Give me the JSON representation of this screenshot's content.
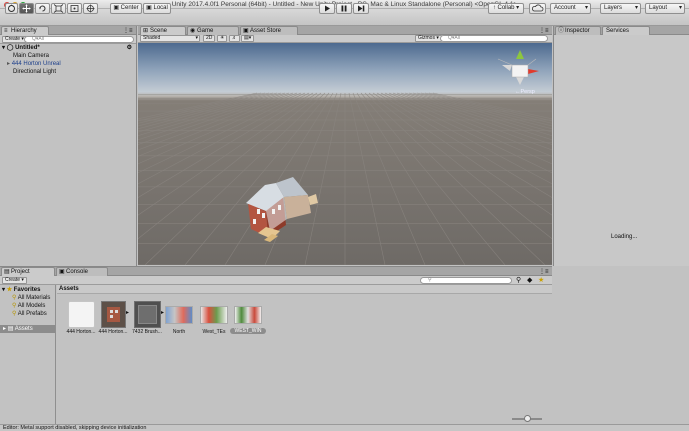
{
  "window": {
    "title": "Unity 2017.4.0f1 Personal (64bit) - Untitled - New Unity Project - PC, Mac & Linux Standalone (Personal) <OpenGL 4.1>"
  },
  "toolbar": {
    "pivot_label": "Center",
    "space_label": "Local",
    "collab_label": "Collab ▾",
    "account_label": "Account",
    "layers_label": "Layers",
    "layout_label": "Layout"
  },
  "hierarchy": {
    "tab_label": "Hierarchy",
    "create_label": "Create ▾",
    "search_placeholder": "Q▾All",
    "scene_name": "Untitled*",
    "items": [
      {
        "label": "Main Camera"
      },
      {
        "label": "444 Horton Unreal"
      },
      {
        "label": "Directional Light"
      }
    ]
  },
  "scene": {
    "tabs": [
      {
        "label": "Scene"
      },
      {
        "label": "Game"
      },
      {
        "label": "Asset Store"
      }
    ],
    "shading_mode": "Shaded",
    "mode_2d": "2D",
    "gizmos_label": "Gizmos ▾",
    "search_placeholder": "Q▾All",
    "persp_label": "←Persp"
  },
  "inspector": {
    "tab_label": "Inspector",
    "services_label": "Services",
    "loading_text": "Loading..."
  },
  "project": {
    "tabs": [
      {
        "label": "Project"
      },
      {
        "label": "Console"
      }
    ],
    "create_label": "Create ▾",
    "favorites_label": "Favorites",
    "favorites": [
      {
        "label": "All Materials"
      },
      {
        "label": "All Models"
      },
      {
        "label": "All Prefabs"
      }
    ],
    "assets_root_label": "Assets",
    "breadcrumb": "Assets",
    "assets": [
      {
        "label": "444 Horton..."
      },
      {
        "label": "444 Horton..."
      },
      {
        "label": "7432 Brush..."
      },
      {
        "label": "North"
      },
      {
        "label": "West_TEs"
      },
      {
        "label": "WEST_WIN"
      }
    ]
  },
  "status_bar": {
    "message": "Editor: Metal support disabled, skipping device initialization"
  },
  "colors": {
    "accent": "#3b6ed6",
    "toolbar_active": "#5e5e5e",
    "selection": "#8c8c8c"
  }
}
